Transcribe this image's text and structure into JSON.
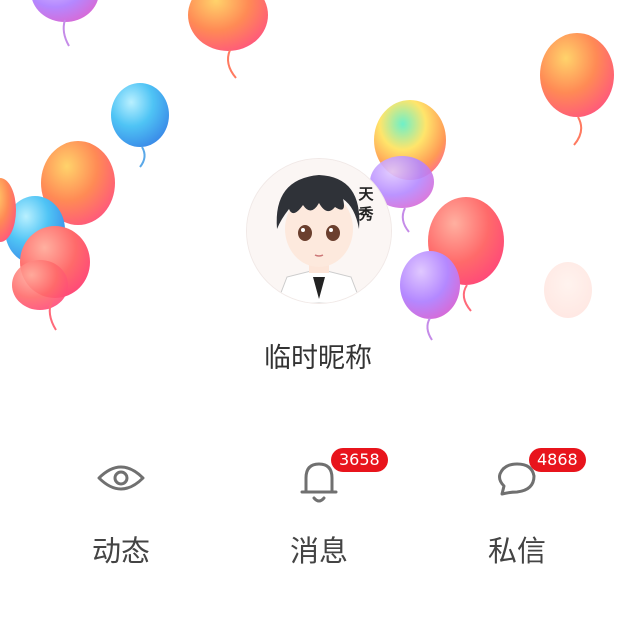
{
  "profile": {
    "avatar_tag_line1": "天",
    "avatar_tag_line2": "秀",
    "nickname": "临时昵称"
  },
  "tabs": [
    {
      "label": "动态",
      "icon": "eye-icon"
    },
    {
      "label": "消息",
      "icon": "bell-icon",
      "badge": "3658"
    },
    {
      "label": "私信",
      "icon": "chat-bubble-icon",
      "badge": "4868"
    }
  ],
  "colors": {
    "badge": "#e8141c",
    "icon": "#707070",
    "label": "#444444"
  }
}
